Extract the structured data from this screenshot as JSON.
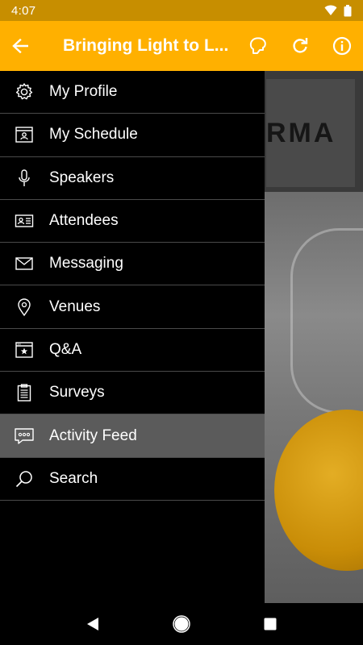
{
  "status_bar": {
    "time": "4:07"
  },
  "app_bar": {
    "title": "Bringing Light to L..."
  },
  "background": {
    "banner_text": "RMA"
  },
  "drawer": {
    "items": [
      {
        "label": "My Profile",
        "icon": "gear-icon"
      },
      {
        "label": "My Schedule",
        "icon": "calendar-person-icon"
      },
      {
        "label": "Speakers",
        "icon": "microphone-icon"
      },
      {
        "label": "Attendees",
        "icon": "id-card-icon"
      },
      {
        "label": "Messaging",
        "icon": "envelope-icon"
      },
      {
        "label": "Venues",
        "icon": "location-pin-icon"
      },
      {
        "label": "Q&A",
        "icon": "browser-star-icon"
      },
      {
        "label": "Surveys",
        "icon": "clipboard-icon"
      },
      {
        "label": "Activity Feed",
        "icon": "chat-bubble-icon",
        "active": true
      },
      {
        "label": "Search",
        "icon": "search-icon"
      }
    ]
  },
  "colors": {
    "accent": "#ffb000",
    "status_bar": "#c78e00",
    "active_item": "#5b5b5b",
    "divider": "#4a4a4a"
  }
}
